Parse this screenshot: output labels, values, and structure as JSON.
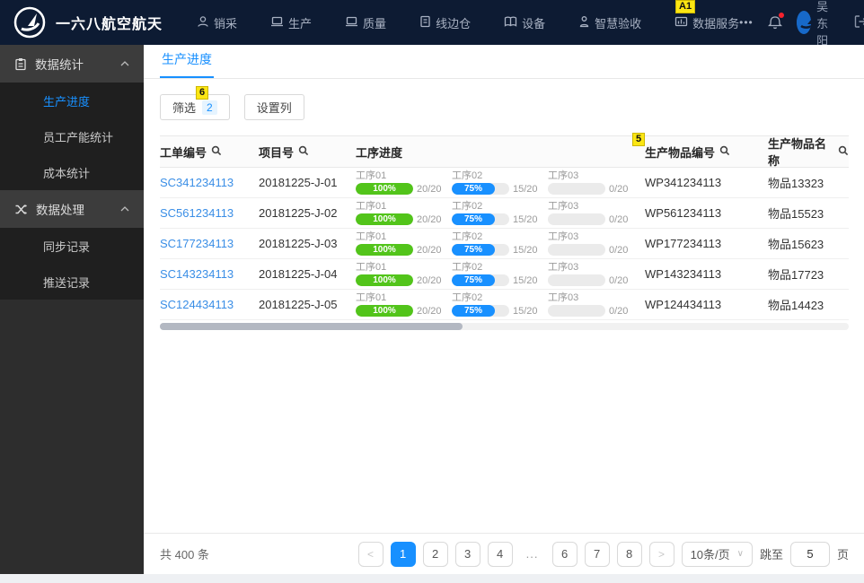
{
  "navbar": {
    "brand": "一六八航空航天",
    "items": [
      {
        "label": "销采",
        "icon": "user-icon"
      },
      {
        "label": "生产",
        "icon": "laptop-icon"
      },
      {
        "label": "质量",
        "icon": "laptop-icon"
      },
      {
        "label": "线边仓",
        "icon": "document-icon"
      },
      {
        "label": "设备",
        "icon": "book-icon"
      },
      {
        "label": "智慧验收",
        "icon": "person-check-icon"
      },
      {
        "label": "数据服务",
        "icon": "chart-monitor-icon"
      }
    ],
    "more_label": "•••",
    "user_name": "吴东阳",
    "logout_label": "退出"
  },
  "sidebar": {
    "groups": [
      {
        "label": "数据统计",
        "icon": "clipboard-icon",
        "items": [
          {
            "label": "生产进度",
            "active": true
          },
          {
            "label": "员工产能统计",
            "active": false
          },
          {
            "label": "成本统计",
            "active": false
          }
        ]
      },
      {
        "label": "数据处理",
        "icon": "shuffle-icon",
        "items": [
          {
            "label": "同步记录",
            "active": false
          },
          {
            "label": "推送记录",
            "active": false
          }
        ]
      }
    ]
  },
  "tabs": {
    "active_label": "生产进度"
  },
  "toolbar": {
    "filter_label": "筛选",
    "filter_badge": "2",
    "columns_label": "设置列"
  },
  "table": {
    "headers": [
      "工单编号",
      "项目号",
      "工序进度",
      "生产物品编号",
      "生产物品名称"
    ],
    "rows": [
      {
        "work_order": "SC341234113",
        "project": "20181225-J-01",
        "item_code": "WP341234113",
        "item_name": "物品13323",
        "processes": [
          {
            "label": "工序01",
            "percent": 100,
            "percent_label": "100%",
            "count": "20/20",
            "color": "green"
          },
          {
            "label": "工序02",
            "percent": 75,
            "percent_label": "75%",
            "count": "15/20",
            "color": "blue"
          },
          {
            "label": "工序03",
            "percent": 0,
            "percent_label": "",
            "count": "0/20",
            "color": "gray"
          }
        ]
      },
      {
        "work_order": "SC561234113",
        "project": "20181225-J-02",
        "item_code": "WP561234113",
        "item_name": "物品15523",
        "processes": [
          {
            "label": "工序01",
            "percent": 100,
            "percent_label": "100%",
            "count": "20/20",
            "color": "green"
          },
          {
            "label": "工序02",
            "percent": 75,
            "percent_label": "75%",
            "count": "15/20",
            "color": "blue"
          },
          {
            "label": "工序03",
            "percent": 0,
            "percent_label": "",
            "count": "0/20",
            "color": "gray"
          }
        ]
      },
      {
        "work_order": "SC177234113",
        "project": "20181225-J-03",
        "item_code": "WP177234113",
        "item_name": "物品15623",
        "processes": [
          {
            "label": "工序01",
            "percent": 100,
            "percent_label": "100%",
            "count": "20/20",
            "color": "green"
          },
          {
            "label": "工序02",
            "percent": 75,
            "percent_label": "75%",
            "count": "15/20",
            "color": "blue"
          },
          {
            "label": "工序03",
            "percent": 0,
            "percent_label": "",
            "count": "0/20",
            "color": "gray"
          }
        ]
      },
      {
        "work_order": "SC143234113",
        "project": "20181225-J-04",
        "item_code": "WP143234113",
        "item_name": "物品17723",
        "processes": [
          {
            "label": "工序01",
            "percent": 100,
            "percent_label": "100%",
            "count": "20/20",
            "color": "green"
          },
          {
            "label": "工序02",
            "percent": 75,
            "percent_label": "75%",
            "count": "15/20",
            "color": "blue"
          },
          {
            "label": "工序03",
            "percent": 0,
            "percent_label": "",
            "count": "0/20",
            "color": "gray"
          }
        ]
      },
      {
        "work_order": "SC124434113",
        "project": "20181225-J-05",
        "item_code": "WP124434113",
        "item_name": "物品14423",
        "processes": [
          {
            "label": "工序01",
            "percent": 100,
            "percent_label": "100%",
            "count": "20/20",
            "color": "green"
          },
          {
            "label": "工序02",
            "percent": 75,
            "percent_label": "75%",
            "count": "15/20",
            "color": "blue"
          },
          {
            "label": "工序03",
            "percent": 0,
            "percent_label": "",
            "count": "0/20",
            "color": "gray"
          }
        ]
      }
    ]
  },
  "pagination": {
    "total": "共 400 条",
    "prev": "<",
    "next": ">",
    "pages": [
      "1",
      "2",
      "3",
      "4",
      "...",
      "6",
      "7",
      "8"
    ],
    "active_page": "1",
    "page_size": "10条/页",
    "select_chevron": "∨",
    "jump_label": "跳至",
    "jump_value": "5",
    "jump_suffix": "页"
  },
  "annotations": {
    "a1": "A1",
    "n6": "6",
    "n5": "5"
  },
  "colors": {
    "navbar_bg": "#0d1b33",
    "accent": "#1890ff",
    "link": "#3a8ee6",
    "progress_green": "#52c41a",
    "progress_blue": "#1890ff",
    "annotation_yellow": "#fbe613",
    "badge_bg": "#e6f4ff"
  }
}
